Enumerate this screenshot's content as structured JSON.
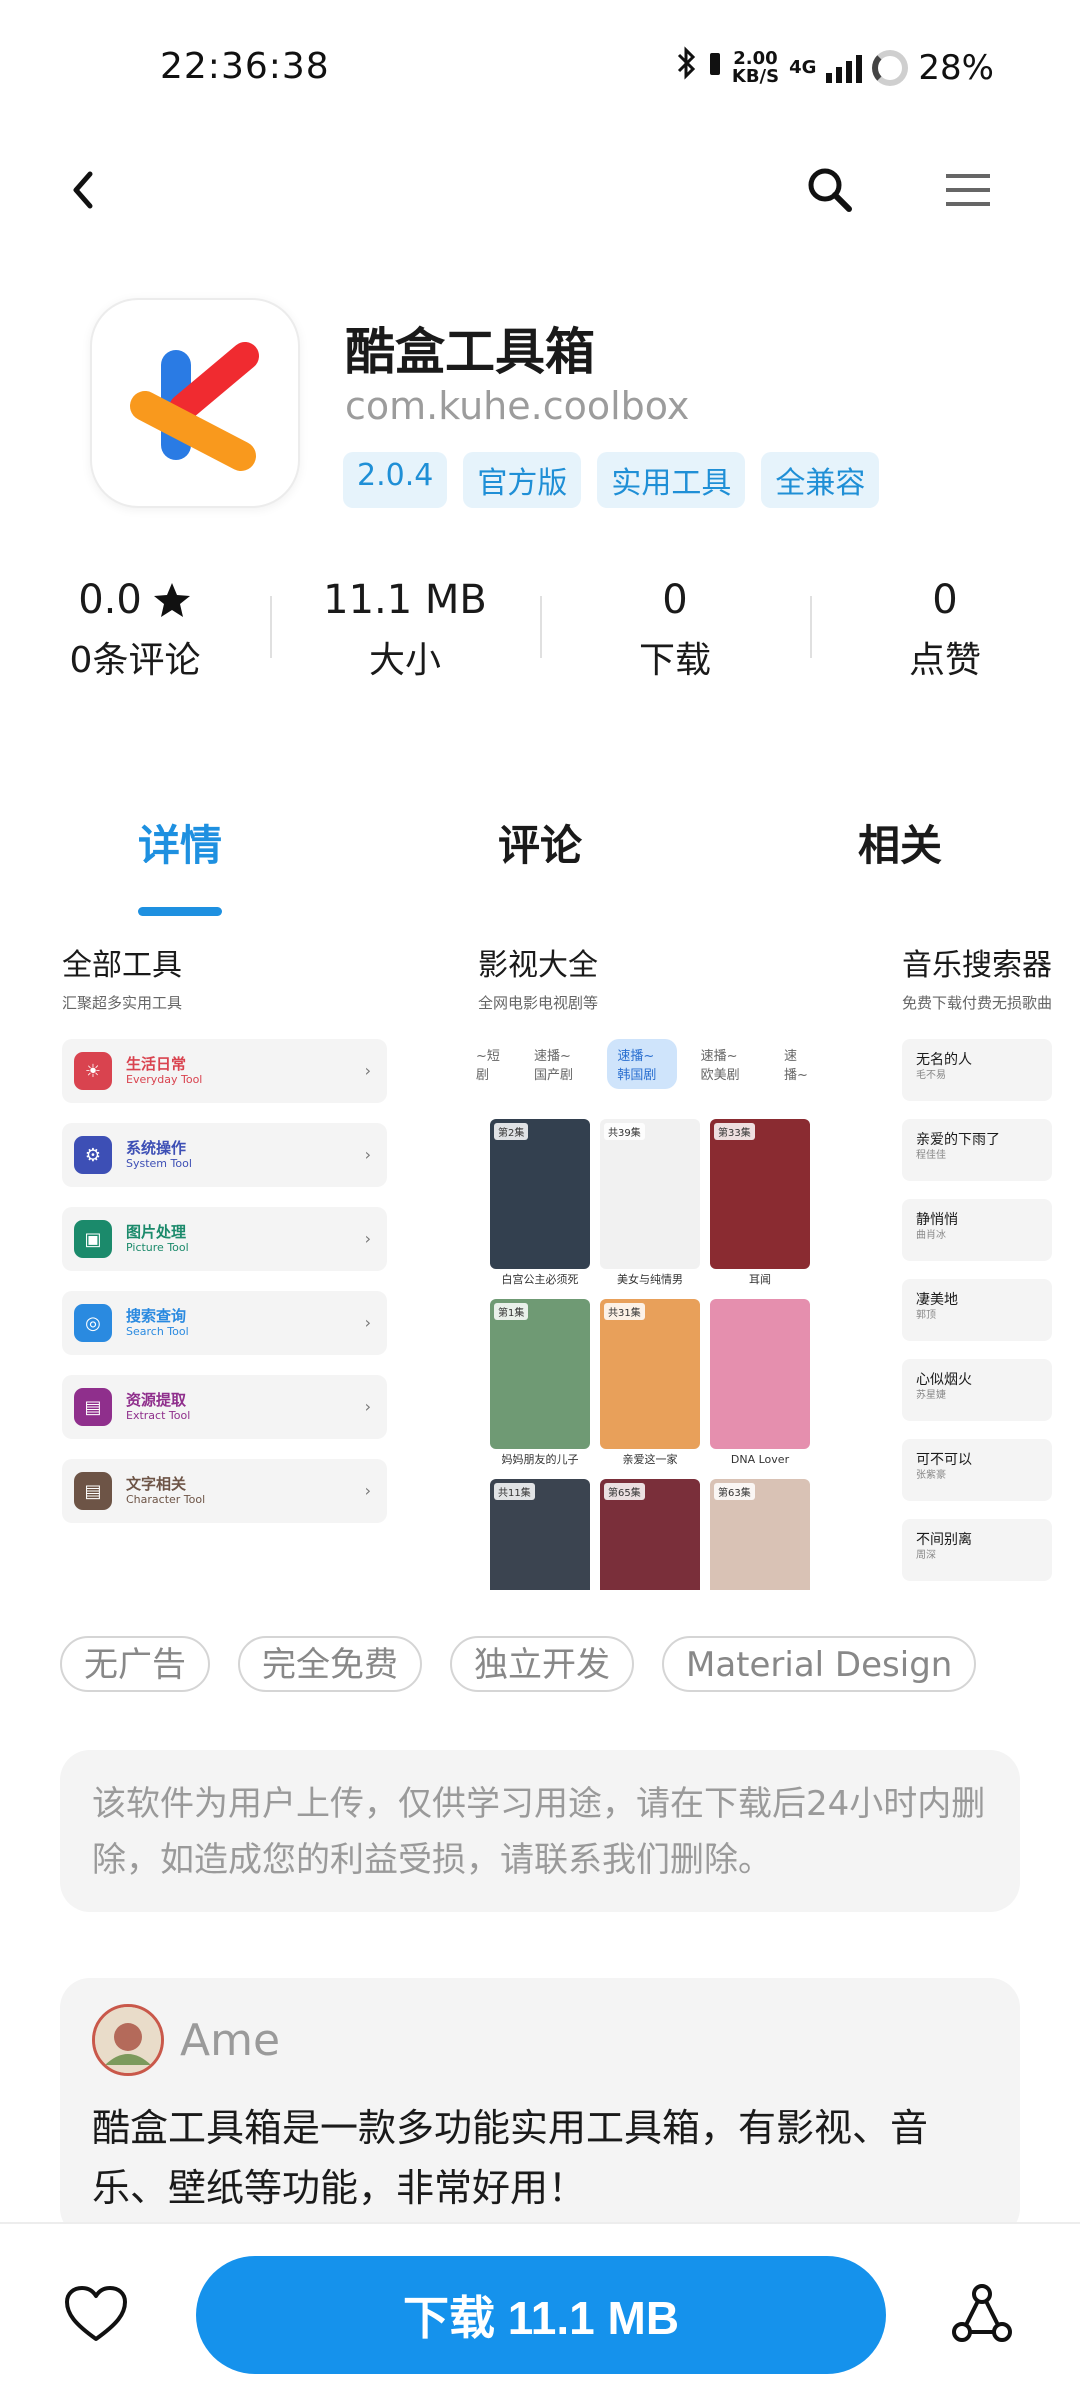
{
  "status_bar": {
    "time": "22:36:38",
    "net_speed_value": "2.00",
    "net_speed_unit": "KB/S",
    "network": "4G",
    "battery": "28%"
  },
  "app": {
    "name": "酷盒工具箱",
    "package": "com.kuhe.coolbox",
    "tags": [
      "2.0.4",
      "官方版",
      "实用工具",
      "全兼容"
    ]
  },
  "stats": [
    {
      "value": "0.0",
      "label": "0条评论",
      "icon": "star-icon"
    },
    {
      "value": "11.1 MB",
      "label": "大小"
    },
    {
      "value": "0",
      "label": "下载"
    },
    {
      "value": "0",
      "label": "点赞"
    }
  ],
  "tabs": [
    {
      "label": "详情",
      "active": true
    },
    {
      "label": "评论",
      "active": false
    },
    {
      "label": "相关",
      "active": false
    }
  ],
  "screenshots": {
    "tools": {
      "title": "全部工具",
      "subtitle": "汇聚超多实用工具",
      "items": [
        {
          "name": "生活日常",
          "en": "Everyday Tool",
          "color": "#d9434f",
          "icon": "sun-icon"
        },
        {
          "name": "系统操作",
          "en": "System Tool",
          "color": "#3d4fb5",
          "icon": "gear-icon"
        },
        {
          "name": "图片处理",
          "en": "Picture Tool",
          "color": "#1b8a6b",
          "icon": "image-icon"
        },
        {
          "name": "搜索查询",
          "en": "Search Tool",
          "color": "#2a8ae0",
          "icon": "globe-icon"
        },
        {
          "name": "资源提取",
          "en": "Extract Tool",
          "color": "#8f2f8c",
          "icon": "box-icon"
        },
        {
          "name": "文字相关",
          "en": "Character Tool",
          "color": "#6d5446",
          "icon": "doc-icon"
        }
      ]
    },
    "video": {
      "title": "影视大全",
      "subtitle": "全网电影电视剧等",
      "categories": [
        "~短剧",
        "速播~国产剧",
        "速播~韩国剧",
        "速播~欧美剧",
        "速播~"
      ],
      "selected_category": 2,
      "posters": [
        {
          "ep": "第2集",
          "caption": "白宫公主必须死",
          "color": "#33404f"
        },
        {
          "ep": "共39集",
          "caption": "美女与纯情男",
          "color": "#f1f1f1"
        },
        {
          "ep": "第33集",
          "caption": "耳闻",
          "color": "#8a2b31"
        },
        {
          "ep": "第1集",
          "caption": "妈妈朋友的儿子",
          "color": "#6f9a74"
        },
        {
          "ep": "共31集",
          "caption": "亲爱这一家",
          "color": "#e8a05a"
        },
        {
          "ep": "",
          "caption": "DNA Lover",
          "color": "#e58fae"
        },
        {
          "ep": "共11集",
          "caption": "",
          "color": "#3b4450"
        },
        {
          "ep": "第65集",
          "caption": "",
          "color": "#7a2f3a"
        },
        {
          "ep": "第63集",
          "caption": "",
          "color": "#d9c2b5"
        }
      ]
    },
    "music": {
      "title": "音乐搜索器",
      "subtitle": "免费下载付费无损歌曲",
      "songs": [
        {
          "title": "无名的人",
          "artist": "毛不易"
        },
        {
          "title": "亲爱的下雨了",
          "artist": "程佳佳"
        },
        {
          "title": "静悄悄",
          "artist": "曲肖冰"
        },
        {
          "title": "凄美地",
          "artist": "郭顶"
        },
        {
          "title": "心似烟火",
          "artist": "苏星婕"
        },
        {
          "title": "可不可以",
          "artist": "张紫豪"
        },
        {
          "title": "不间别离",
          "artist": "周深"
        }
      ]
    }
  },
  "features": [
    "无广告",
    "完全免费",
    "独立开发",
    "Material Design"
  ],
  "notice": "该软件为用户上传，仅供学习用途，请在下载后24小时内删除，如造成您的利益受损，请联系我们删除。",
  "review": {
    "user": "Ame",
    "text": "酷盒工具箱是一款多功能实用工具箱，有影视、音乐、壁纸等功能，非常好用！"
  },
  "bottom": {
    "download_label": "下载 11.1 MB"
  },
  "colors": {
    "accent": "#1592ec",
    "tab_active": "#1e90e0",
    "tag_bg": "#e6f3fb",
    "tag_text": "#1f8fd6"
  }
}
